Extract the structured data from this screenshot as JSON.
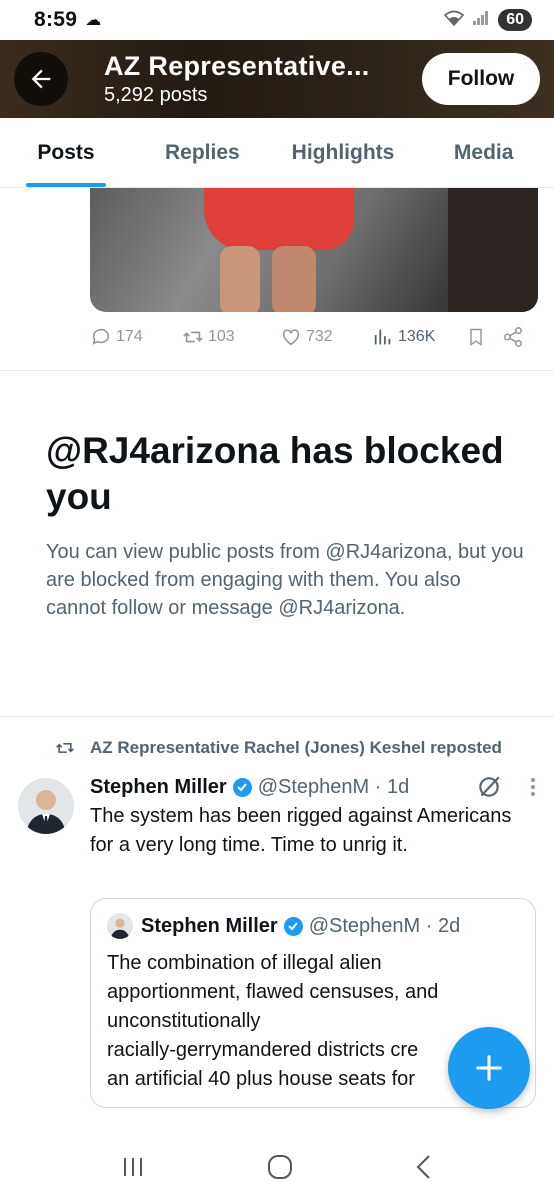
{
  "status_bar": {
    "time": "8:59",
    "battery": "60"
  },
  "header": {
    "title": "AZ Representative...",
    "post_count": "5,292 posts",
    "follow_label": "Follow"
  },
  "tabs": [
    {
      "label": "Posts",
      "active": true
    },
    {
      "label": "Replies",
      "active": false
    },
    {
      "label": "Highlights",
      "active": false
    },
    {
      "label": "Media",
      "active": false
    }
  ],
  "post1_actions": {
    "replies": "174",
    "reposts": "103",
    "likes": "732",
    "views": "136K"
  },
  "blocked_notice": {
    "title": "@RJ4arizona has blocked you",
    "body": "You can view public posts from @RJ4arizona, but you are blocked from engaging with them. You also cannot follow or message @RJ4arizona."
  },
  "repost_banner": "AZ Representative Rachel (Jones) Keshel reposted",
  "tweet": {
    "name": "Stephen Miller",
    "handle": "@StephenM · 1d",
    "text": "The system has been rigged against Americans for a very long time. Time to unrig it."
  },
  "quoted_tweet": {
    "name": "Stephen Miller",
    "handle": "@StephenM · 2d",
    "lines": [
      "The combination of illegal alien",
      "apportionment, flawed censuses, and",
      "unconstitutionally",
      "racially-gerrymandered districts cre",
      "an artificial 40 plus house seats for"
    ]
  },
  "colors": {
    "accent": "#1d9bf0",
    "text": "#0f1419",
    "muted": "#536471"
  }
}
